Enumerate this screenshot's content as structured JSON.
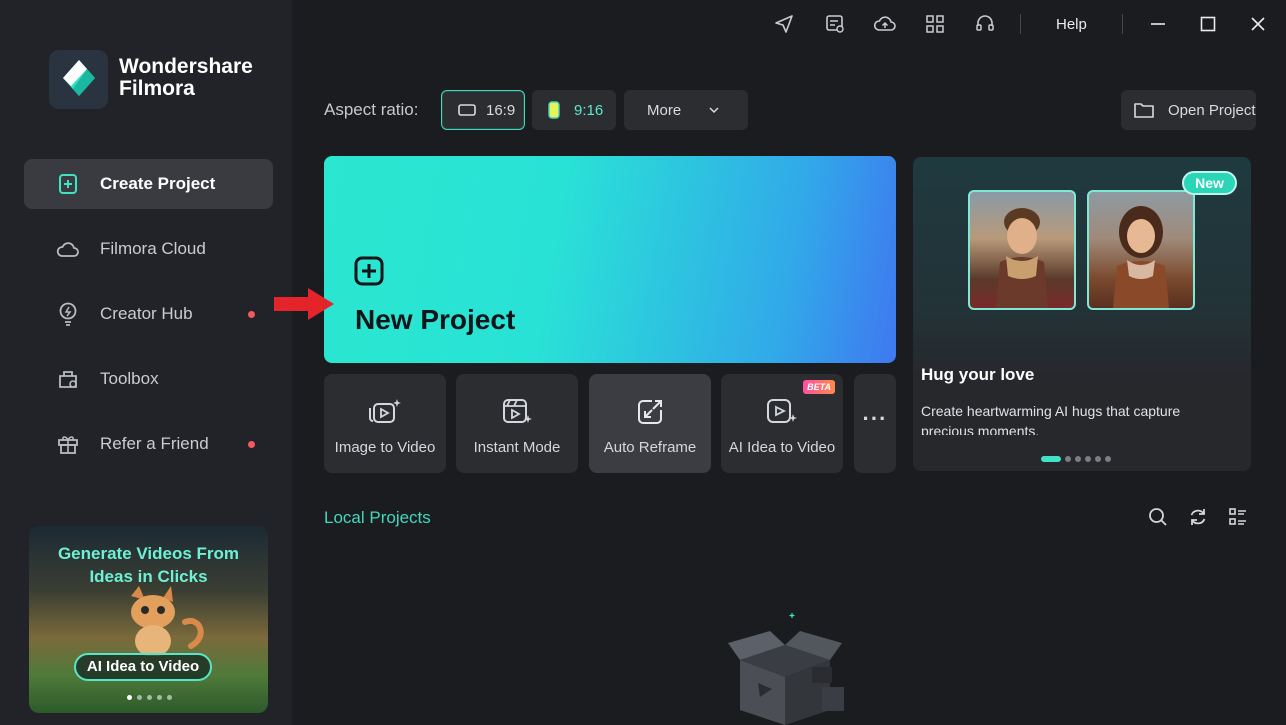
{
  "app": {
    "brand_line1": "Wondershare",
    "brand_line2": "Filmora"
  },
  "sidebar": {
    "items": [
      {
        "label": "Create Project",
        "icon": "plus-square-icon",
        "active": true
      },
      {
        "label": "Filmora Cloud",
        "icon": "cloud-icon"
      },
      {
        "label": "Creator Hub",
        "icon": "lightbulb-icon",
        "dot": true
      },
      {
        "label": "Toolbox",
        "icon": "toolbox-icon"
      },
      {
        "label": "Refer a Friend",
        "icon": "gift-icon",
        "dot": true
      }
    ],
    "promo": {
      "title_line1": "Generate Videos From",
      "title_line2": "Ideas in Clicks",
      "button": "AI Idea to Video",
      "slides": 5,
      "active_slide": 0
    }
  },
  "titlebar": {
    "icons": [
      "send-icon",
      "feedback-icon",
      "cloud-upload-icon",
      "apps-grid-icon",
      "headset-icon"
    ],
    "help": "Help"
  },
  "aspect": {
    "label": "Aspect ratio:",
    "options": [
      {
        "label": "16:9",
        "selected": true
      },
      {
        "label": "9:16"
      },
      {
        "label": "More"
      }
    ],
    "open_project": "Open Project"
  },
  "new_project": {
    "label": "New Project",
    "accent": "#2ae7cf"
  },
  "tools": [
    {
      "label": "Image to Video",
      "icon": "image-to-video-icon"
    },
    {
      "label": "Instant Mode",
      "icon": "instant-mode-icon"
    },
    {
      "label": "Auto Reframe",
      "icon": "auto-reframe-icon",
      "hovered": true
    },
    {
      "label": "AI Idea to Video",
      "icon": "ai-idea-video-icon",
      "badge": "BETA"
    }
  ],
  "tools_more": "···",
  "feature": {
    "badge": "New",
    "title": "Hug your love",
    "description": "Create heartwarming AI hugs that capture precious moments.",
    "slides": 6,
    "active_slide": 0
  },
  "local_projects": {
    "title": "Local Projects",
    "icons": [
      "search-icon",
      "refresh-icon",
      "list-view-icon"
    ]
  }
}
